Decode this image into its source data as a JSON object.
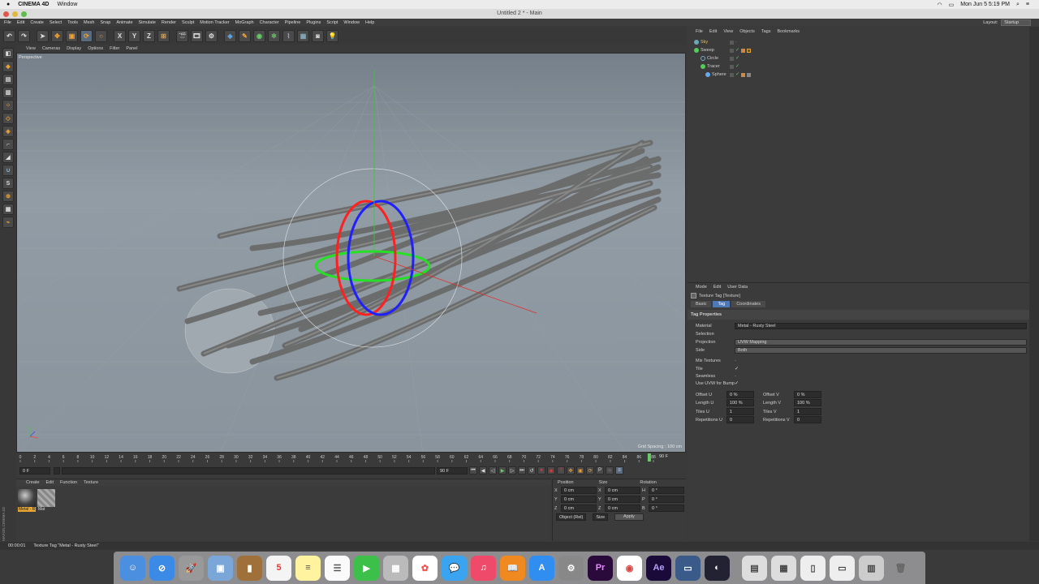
{
  "macbar": {
    "apple": "",
    "app": "CINEMA 4D",
    "menu": "Window",
    "clock": "Mon Jun 5  5:19 PM"
  },
  "window": {
    "title": "Untitled 2 * - Main"
  },
  "appmenu": {
    "items": [
      "File",
      "Edit",
      "Create",
      "Select",
      "Tools",
      "Mesh",
      "Snap",
      "Animate",
      "Simulate",
      "Render",
      "Sculpt",
      "Motion Tracker",
      "MoGraph",
      "Character",
      "Pipeline",
      "Plugins",
      "Script",
      "Window",
      "Help"
    ],
    "layout_label": "Layout:",
    "layout_value": "Startup"
  },
  "toolbar": {
    "x": "X",
    "y": "Y",
    "z": "Z"
  },
  "lefttools": {
    "s": "S"
  },
  "viewport": {
    "menu": [
      "View",
      "Cameras",
      "Display",
      "Options",
      "Filter",
      "Panel"
    ],
    "label": "Perspective",
    "grid_spacing": "Grid Spacing : 100 cm"
  },
  "timeline": {
    "ticks": [
      "0",
      "2",
      "4",
      "6",
      "8",
      "10",
      "12",
      "14",
      "16",
      "18",
      "20",
      "22",
      "24",
      "26",
      "28",
      "30",
      "32",
      "34",
      "36",
      "38",
      "40",
      "42",
      "44",
      "46",
      "48",
      "50",
      "52",
      "54",
      "56",
      "58",
      "60",
      "62",
      "64",
      "66",
      "68",
      "70",
      "72",
      "74",
      "76",
      "78",
      "80",
      "82",
      "84",
      "86",
      "88"
    ],
    "end": "90 F",
    "current": "0 F",
    "start_field": "0 F",
    "end_field": "90 F",
    "end_field2": "90 F"
  },
  "material_manager": {
    "menu": [
      "Create",
      "Edit",
      "Function",
      "Texture"
    ],
    "materials": [
      "Metal - R",
      "Mat"
    ],
    "brand": "MAXON CINEMA 4D"
  },
  "coordinates": {
    "headers": [
      "Position",
      "Size",
      "Rotation"
    ],
    "rows": [
      {
        "axis": "X",
        "pos": "0 cm",
        "size_axis": "X",
        "size": "0 cm",
        "rot_axis": "H",
        "rot": "0 °"
      },
      {
        "axis": "Y",
        "pos": "0 cm",
        "size_axis": "Y",
        "size": "0 cm",
        "rot_axis": "P",
        "rot": "0 °"
      },
      {
        "axis": "Z",
        "pos": "0 cm",
        "size_axis": "Z",
        "size": "0 cm",
        "rot_axis": "B",
        "rot": "0 °"
      }
    ],
    "mode": "Object (Rel)",
    "size_mode": "Size",
    "apply": "Apply"
  },
  "object_manager": {
    "menu": [
      "File",
      "Edit",
      "View",
      "Objects",
      "Tags",
      "Bookmarks"
    ],
    "objects": [
      "Sky",
      "Sweep",
      "Circle",
      "Tracer",
      "Sphere"
    ]
  },
  "attribute_manager": {
    "menu": [
      "Mode",
      "Edit",
      "User Data"
    ],
    "title": "Texture Tag [Texture]",
    "tabs": [
      "Basic",
      "Tag",
      "Coordinates"
    ],
    "section": "Tag Properties",
    "material_label": "Material",
    "material_value": "Metal - Rusty Steel",
    "selection_label": "Selection",
    "projection_label": "Projection",
    "projection_value": "UVW Mapping",
    "side_label": "Side",
    "side_value": "Both",
    "mix_label": "Mix Textures",
    "tile_label": "Tile",
    "tile_check": "✓",
    "seamless_label": "Seamless",
    "uvw_bump_label": "Use UVW for Bump",
    "uvw_bump_check": "✓",
    "offset_u_label": "Offset U",
    "offset_u": "0 %",
    "offset_v_label": "Offset V",
    "offset_v": "0 %",
    "length_u_label": "Length U",
    "length_u": "100 %",
    "length_v_label": "Length V",
    "length_v": "100 %",
    "tiles_u_label": "Tiles U",
    "tiles_u": "1",
    "tiles_v_label": "Tiles V",
    "tiles_v": "1",
    "rep_u_label": "Repetitions U",
    "rep_u": "0",
    "rep_v_label": "Repetitions V",
    "rep_v": "0"
  },
  "status": {
    "time": "00:00:01",
    "message": "Texture Tag \"Metal - Rusty Steel\""
  }
}
